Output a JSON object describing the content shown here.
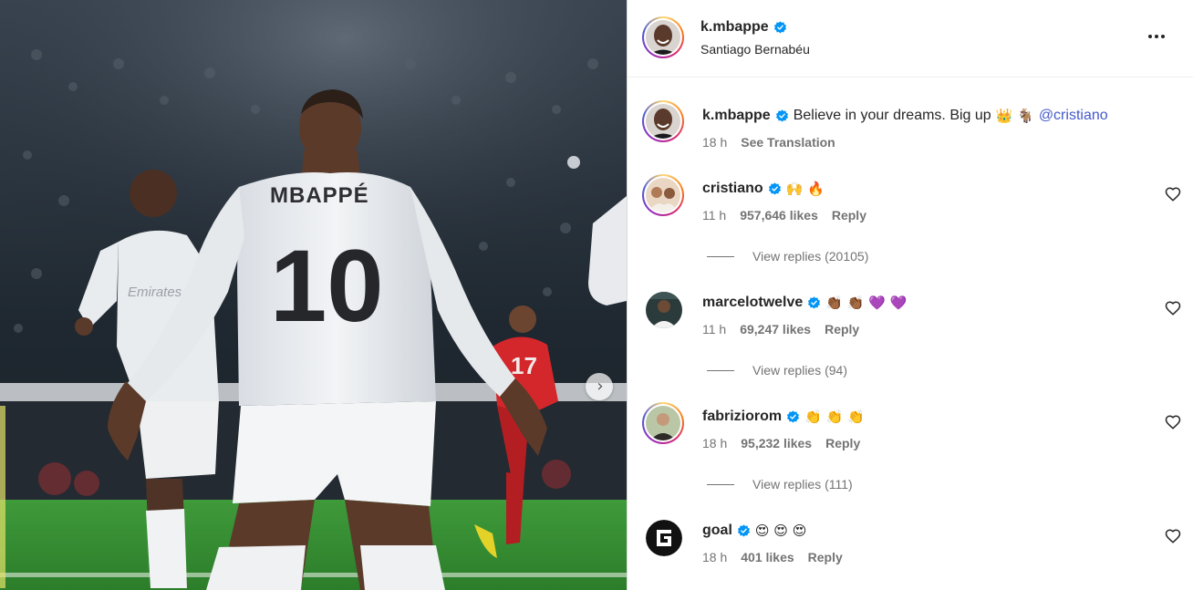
{
  "post": {
    "username": "k.mbappe",
    "location": "Santiago Bernabéu",
    "caption": "Believe in your dreams. Big up",
    "caption_emojis": "👑 🐐",
    "caption_mention": "@cristiano",
    "time": "18 h",
    "see_translation": "See Translation",
    "jersey_name": "MBAPPÉ",
    "jersey_number": "10",
    "accent_color": "#0095f6",
    "mention_color": "#4459c9"
  },
  "comments": [
    {
      "username": "cristiano",
      "text": "🙌 🔥",
      "time": "11 h",
      "likes": "957,646 likes",
      "reply": "Reply",
      "view_replies": "View replies (20105)"
    },
    {
      "username": "marcelotwelve",
      "text": "👏🏾 👏🏾 💜 💜",
      "time": "11 h",
      "likes": "69,247 likes",
      "reply": "Reply",
      "view_replies": "View replies (94)"
    },
    {
      "username": "fabriziorom",
      "text": "👏 👏 👏",
      "time": "18 h",
      "likes": "95,232 likes",
      "reply": "Reply",
      "view_replies": "View replies (111)"
    },
    {
      "username": "goal",
      "text": "😍 😍 😍",
      "time": "18 h",
      "likes": "401 likes",
      "reply": "Reply"
    }
  ],
  "icons": {
    "more": "more-options-icon",
    "verified": "verified-badge-icon",
    "heart": "heart-outline-icon",
    "next": "chevron-right-icon"
  }
}
